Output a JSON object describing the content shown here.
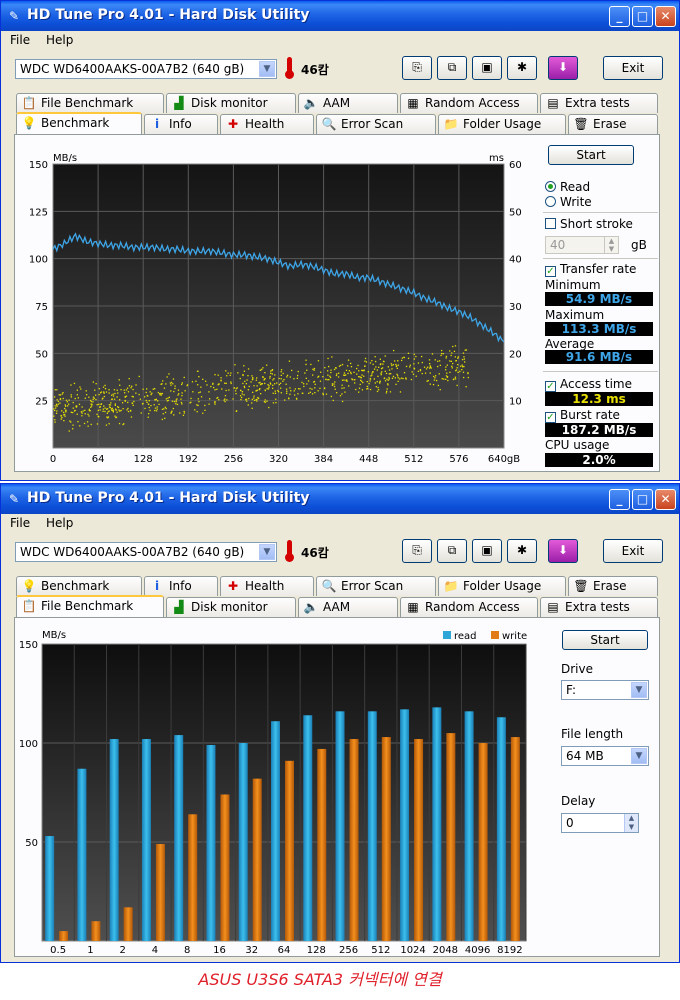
{
  "windows": [
    {
      "title": "HD Tune Pro 4.01 - Hard Disk Utility",
      "menu": {
        "file": "File",
        "help": "Help"
      },
      "drive": "WDC WD6400AAKS-00A7B2     (640 gB)",
      "temperature": "46캄",
      "exit_label": "Exit",
      "tabs_top": [
        "File Benchmark",
        "Disk monitor",
        "AAM",
        "Random Access",
        "Extra tests"
      ],
      "tabs_bottom": [
        "Benchmark",
        "Info",
        "Health",
        "Error Scan",
        "Folder Usage",
        "Erase"
      ],
      "active_tab": "Benchmark"
    },
    {
      "title": "HD Tune Pro 4.01 - Hard Disk Utility",
      "menu": {
        "file": "File",
        "help": "Help"
      },
      "drive": "WDC WD6400AAKS-00A7B2     (640 gB)",
      "temperature": "46캄",
      "exit_label": "Exit",
      "tabs_top": [
        "Benchmark",
        "Info",
        "Health",
        "Error Scan",
        "Folder Usage",
        "Erase"
      ],
      "tabs_bottom": [
        "File Benchmark",
        "Disk monitor",
        "AAM",
        "Random Access",
        "Extra tests"
      ],
      "active_tab": "File Benchmark"
    }
  ],
  "benchmark": {
    "start_label": "Start",
    "read_label": "Read",
    "write_label": "Write",
    "mode": "read",
    "short_stroke_label": "Short stroke",
    "short_stroke_checked": false,
    "short_stroke_value": "40",
    "short_stroke_unit": "gB",
    "transfer_rate_label": "Transfer rate",
    "transfer_rate_checked": true,
    "minimum_label": "Minimum",
    "minimum_value": "54.9 MB/s",
    "maximum_label": "Maximum",
    "maximum_value": "113.3 MB/s",
    "average_label": "Average",
    "average_value": "91.6 MB/s",
    "access_time_label": "Access time",
    "access_time_checked": true,
    "access_time_value": "12.3 ms",
    "burst_rate_label": "Burst rate",
    "burst_rate_checked": true,
    "burst_rate_value": "187.2 MB/s",
    "cpu_usage_label": "CPU usage",
    "cpu_usage_value": "2.0%",
    "value_color_blue": "#3ea6e8",
    "value_color_yellow": "#e8e000"
  },
  "file_benchmark": {
    "start_label": "Start",
    "drive_label": "Drive",
    "drive_value": "F:",
    "file_length_label": "File length",
    "file_length_value": "64 MB",
    "delay_label": "Delay",
    "delay_value": "0"
  },
  "caption": "ASUS U3S6 SATA3 커넥터에 연결",
  "chart_data": [
    {
      "type": "line",
      "ylabel": "MB/s",
      "y2label": "ms",
      "x_unit": "gB",
      "xlim": [
        0,
        640
      ],
      "ylim": [
        0,
        150
      ],
      "y2lim": [
        0,
        60
      ],
      "x_ticks": [
        "0",
        "64",
        "128",
        "192",
        "256",
        "320",
        "384",
        "448",
        "512",
        "576",
        "640gB"
      ],
      "y_ticks": [
        "25",
        "50",
        "75",
        "100",
        "125",
        "150"
      ],
      "y2_ticks": [
        "10",
        "20",
        "30",
        "40",
        "50",
        "60"
      ],
      "grid": true,
      "series": [
        {
          "kind": "line",
          "axis": "left",
          "color": "#3ea6e8",
          "x": [
            0,
            16,
            32,
            48,
            64,
            80,
            96,
            112,
            128,
            144,
            160,
            176,
            192,
            208,
            224,
            240,
            256,
            272,
            288,
            304,
            320,
            336,
            352,
            368,
            384,
            400,
            416,
            432,
            448,
            464,
            480,
            496,
            512,
            528,
            544,
            560,
            576,
            592,
            608,
            624,
            640
          ],
          "values": [
            105,
            108,
            112,
            109,
            108,
            107,
            107,
            106,
            106,
            106,
            105,
            105,
            104,
            104,
            104,
            103,
            102,
            102,
            101,
            100,
            98,
            96,
            97,
            96,
            94,
            92,
            92,
            90,
            90,
            88,
            86,
            84,
            82,
            79,
            77,
            74,
            72,
            69,
            65,
            61,
            56
          ]
        },
        {
          "kind": "scatter",
          "axis": "right",
          "color": "#e8e000",
          "trend_x": [
            0,
            640
          ],
          "trend_ms": [
            8.5,
            18.5
          ],
          "spread_ms": 4
        }
      ]
    },
    {
      "type": "bar",
      "ylabel": "MB/s",
      "ylim": [
        0,
        150
      ],
      "y_ticks": [
        "50",
        "100",
        "150"
      ],
      "categories": [
        "0.5",
        "1",
        "2",
        "4",
        "8",
        "16",
        "32",
        "64",
        "128",
        "256",
        "512",
        "1024",
        "2048",
        "4096",
        "8192"
      ],
      "series": [
        {
          "name": "read",
          "color": "#2ea7d8",
          "values": [
            53,
            87,
            102,
            102,
            104,
            99,
            100,
            111,
            114,
            116,
            116,
            117,
            118,
            116,
            113
          ]
        },
        {
          "name": "write",
          "color": "#e07b18",
          "values": [
            5,
            10,
            17,
            49,
            64,
            74,
            82,
            91,
            97,
            102,
            103,
            102,
            105,
            100,
            103
          ]
        }
      ],
      "grid": true,
      "legend": "top-right"
    }
  ]
}
